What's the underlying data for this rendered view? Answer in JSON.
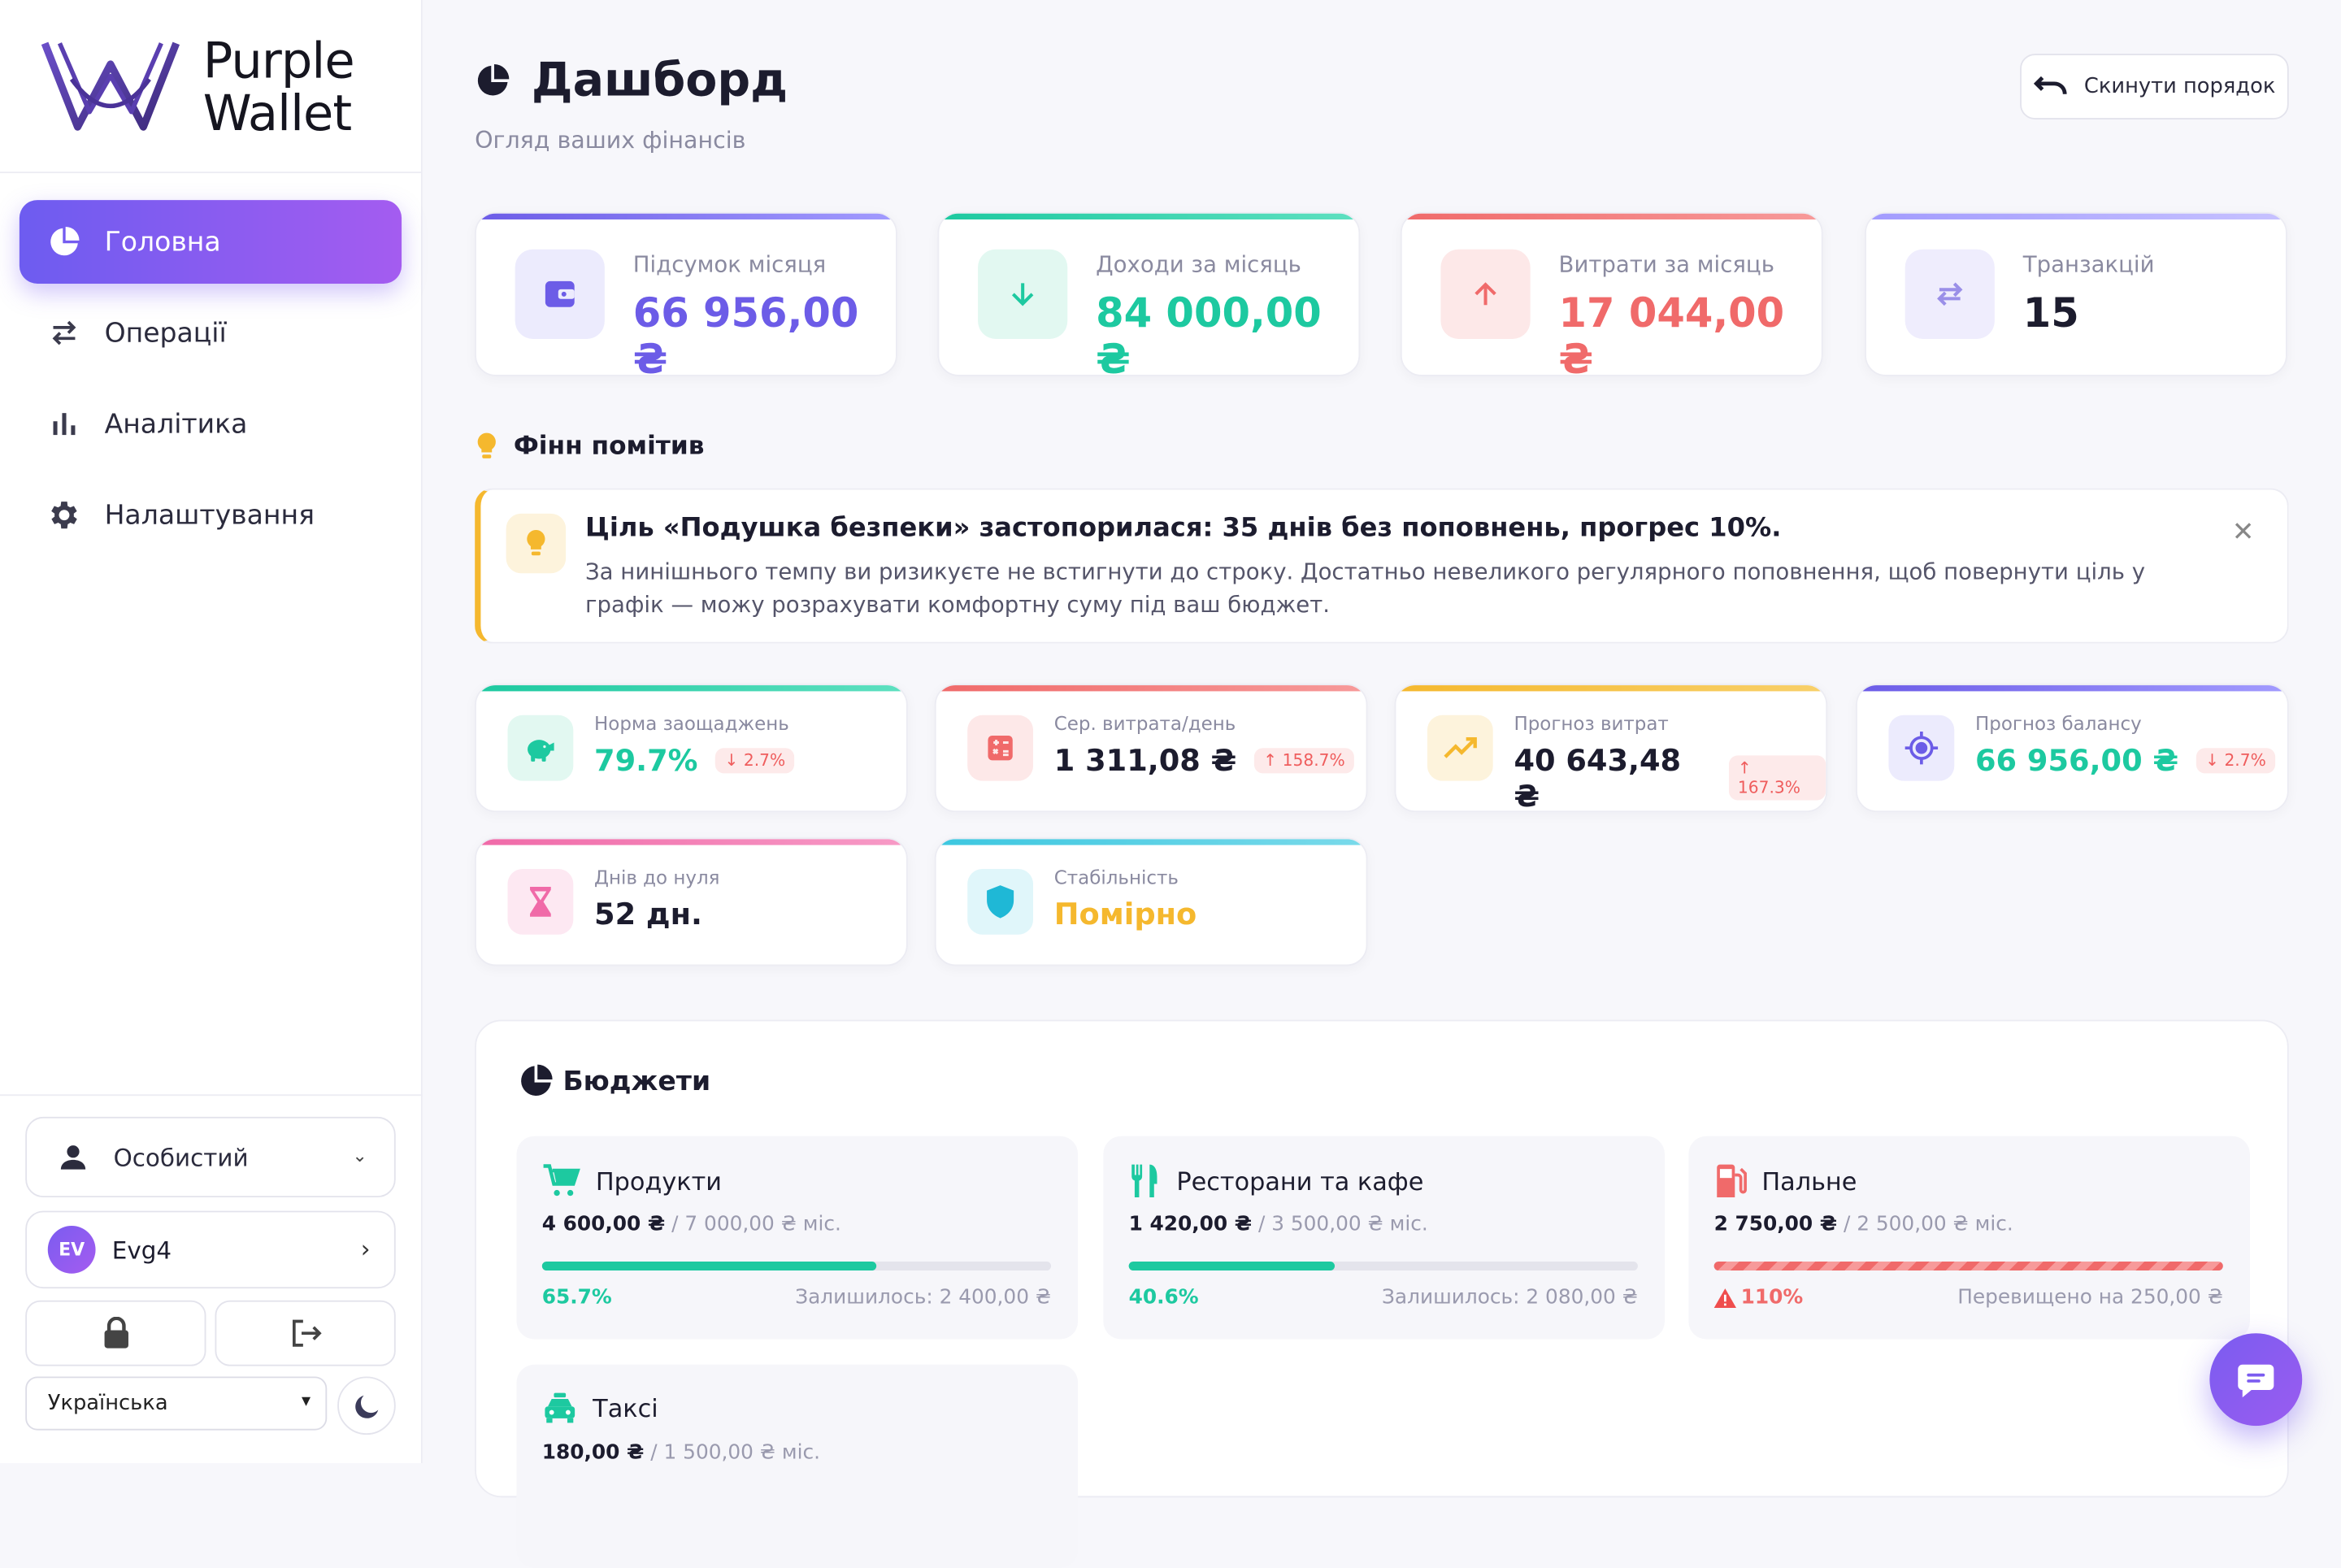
{
  "brand": {
    "name_line1": "Purple",
    "name_line2": "Wallet",
    "accent": "#7b5cf0"
  },
  "sidebar": {
    "items": [
      {
        "label": "Головна",
        "icon": "pie-chart-icon",
        "active": true
      },
      {
        "label": "Операції",
        "icon": "swap-arrows-icon",
        "active": false
      },
      {
        "label": "Аналітика",
        "icon": "bar-chart-icon",
        "active": false
      },
      {
        "label": "Налаштування",
        "icon": "gear-icon",
        "active": false
      }
    ],
    "account": "Особистий",
    "user": {
      "initials": "EV",
      "name": "Evg4"
    },
    "language": "Українська"
  },
  "header": {
    "title": "Дашборд",
    "subtitle": "Огляд ваших фінансів",
    "reset_label": "Скинути порядок"
  },
  "stats": [
    {
      "label": "Підсумок місяця",
      "value": "66 956,00 ₴",
      "color": "#6c5ce7"
    },
    {
      "label": "Доходи за місяць",
      "value": "84 000,00 ₴",
      "color": "#1dc9a0"
    },
    {
      "label": "Витрати за місяць",
      "value": "17 044,00 ₴",
      "color": "#f06a6a"
    },
    {
      "label": "Транзакцій",
      "value": "15",
      "color": "#1c1c2e"
    }
  ],
  "hint": {
    "section_title": "Фінн помітив",
    "title": "Ціль «Подушка безпеки» застопорилася: 35 днів без поповнень, прогрес 10%.",
    "body": "За нинішнього темпу ви ризикуєте не встигнути до строку. Достатньо невеликого регулярного поповнення, щоб повернути ціль у графік — можу розрахувати комфортну суму під ваш бюджет."
  },
  "metrics": [
    {
      "label": "Норма заощаджень",
      "value": "79.7%",
      "badge": "2.7%",
      "badge_dir": "down",
      "value_color": "#1dc9a0"
    },
    {
      "label": "Сер. витрата/день",
      "value": "1 311,08 ₴",
      "badge": "158.7%",
      "badge_dir": "up",
      "value_color": "#1c1c2e"
    },
    {
      "label": "Прогноз витрат",
      "value": "40 643,48 ₴",
      "badge": "167.3%",
      "badge_dir": "up",
      "value_color": "#1c1c2e"
    },
    {
      "label": "Прогноз балансу",
      "value": "66 956,00 ₴",
      "badge": "2.7%",
      "badge_dir": "down",
      "value_color": "#1dc9a0"
    },
    {
      "label": "Днів до нуля",
      "value": "52 дн.",
      "value_color": "#1c1c2e"
    },
    {
      "label": "Стабільність",
      "value": "Помірно",
      "value_color": "#f5b82e"
    }
  ],
  "budgets": {
    "title": "Бюджети",
    "items": [
      {
        "name": "Продукти",
        "spent": "4 600,00 ₴",
        "limit": "/ 7 000,00 ₴",
        "period": "міс.",
        "progress": 0.657,
        "pct": "65.7%",
        "note": "Залишилось: 2 400,00 ₴",
        "color": "#1dc9a0"
      },
      {
        "name": "Ресторани та кафе",
        "spent": "1 420,00 ₴",
        "limit": "/ 3 500,00 ₴",
        "period": "міс.",
        "progress": 0.406,
        "pct": "40.6%",
        "note": "Залишилось: 2 080,00 ₴",
        "color": "#1dc9a0"
      },
      {
        "name": "Пальне",
        "spent": "2 750,00 ₴",
        "limit": "/ 2 500,00 ₴",
        "period": "міс.",
        "progress": 1.0,
        "pct": "110%",
        "note": "Перевищено на 250,00 ₴",
        "color": "#f06a6a"
      },
      {
        "name": "Таксі",
        "spent": "180,00 ₴",
        "limit": "/ 1 500,00 ₴",
        "period": "міс."
      }
    ]
  }
}
